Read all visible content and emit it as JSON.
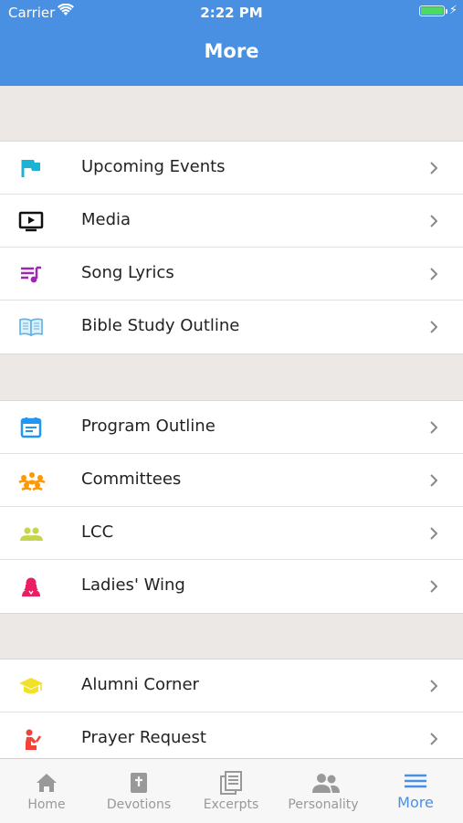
{
  "status_bar": {
    "carrier": "Carrier",
    "time": "2:22 PM"
  },
  "header": {
    "title": "More"
  },
  "groups": [
    {
      "items": [
        {
          "label": "Upcoming Events",
          "icon": "flag-icon",
          "color": "#1bb3d3"
        },
        {
          "label": "Media",
          "icon": "tv-play-icon",
          "color": "#111111"
        },
        {
          "label": "Song Lyrics",
          "icon": "playlist-music-icon",
          "color": "#9c27b0"
        },
        {
          "label": "Bible Study Outline",
          "icon": "open-book-icon",
          "color": "#5ab4e8"
        }
      ]
    },
    {
      "items": [
        {
          "label": "Program Outline",
          "icon": "calendar-icon",
          "color": "#2196f3"
        },
        {
          "label": "Committees",
          "icon": "group-circle-icon",
          "color": "#ff9800"
        },
        {
          "label": "LCC",
          "icon": "people-icon",
          "color": "#c6d64a"
        },
        {
          "label": "Ladies' Wing",
          "icon": "woman-icon",
          "color": "#e91e63"
        }
      ]
    },
    {
      "items": [
        {
          "label": "Alumni Corner",
          "icon": "graduation-cap-icon",
          "color": "#f2e12b"
        },
        {
          "label": "Prayer Request",
          "icon": "kneeling-person-icon",
          "color": "#f44336"
        }
      ]
    }
  ],
  "tabbar": {
    "tabs": [
      {
        "label": "Home",
        "icon": "home-icon",
        "active": false
      },
      {
        "label": "Devotions",
        "icon": "bible-icon",
        "active": false
      },
      {
        "label": "Excerpts",
        "icon": "documents-icon",
        "active": false
      },
      {
        "label": "Personality",
        "icon": "people-icon",
        "active": false
      },
      {
        "label": "More",
        "icon": "menu-lines-icon",
        "active": true
      }
    ],
    "active_color": "#4a90e2",
    "inactive_color": "#999999"
  }
}
